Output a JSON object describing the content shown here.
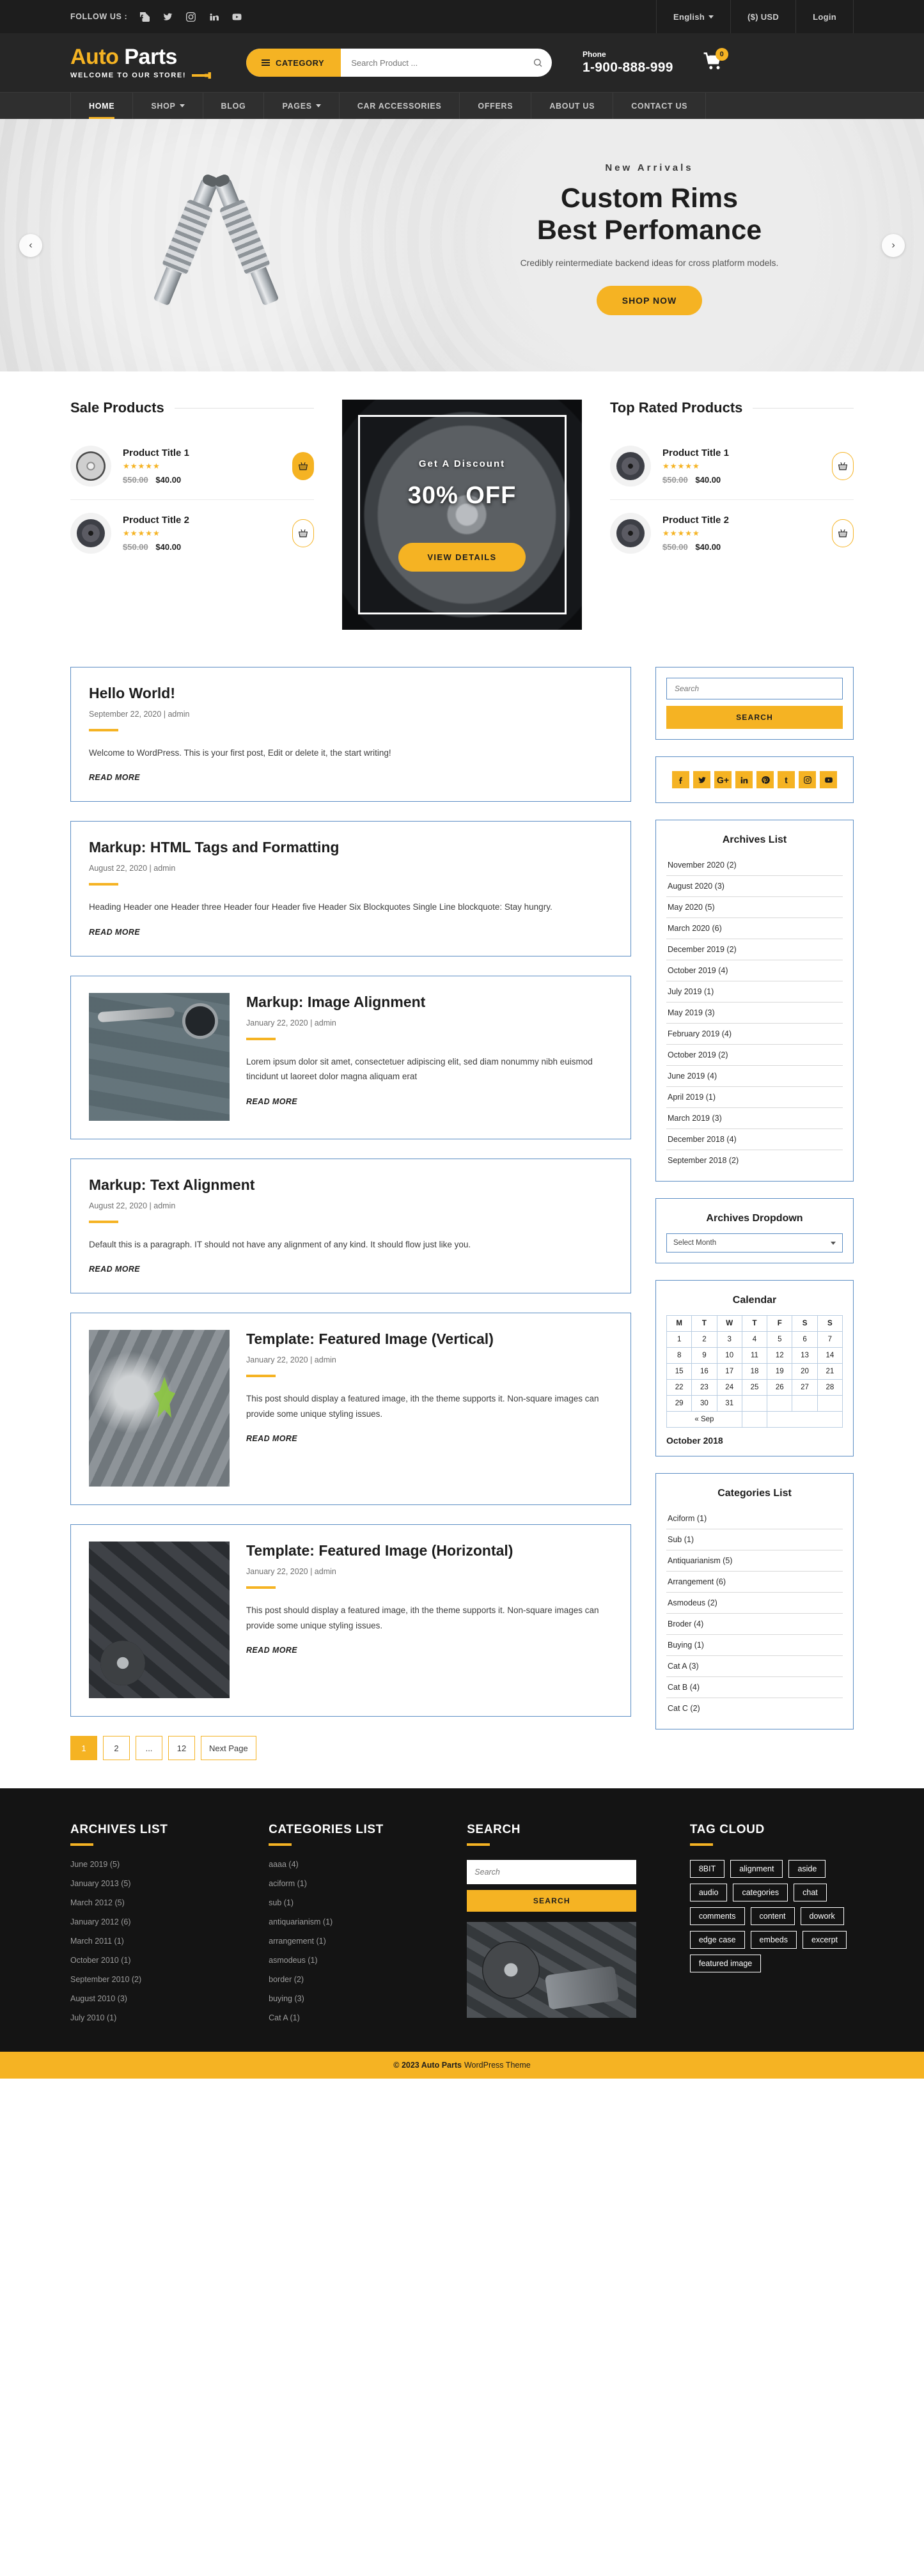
{
  "topbar": {
    "follow_label": "FOLLOW US :",
    "socials": [
      "facebook-icon",
      "twitter-icon",
      "instagram-icon",
      "linkedin-icon",
      "youtube-icon"
    ],
    "language": "English",
    "currency": "($) USD",
    "login": "Login"
  },
  "header": {
    "logo_auto": "Auto",
    "logo_parts": "Parts",
    "logo_tagline": "WELCOME TO OUR STORE!",
    "category_button": "CATEGORY",
    "search_placeholder": "Search Product ...",
    "search_value": "",
    "phone_label": "Phone",
    "phone_number": "1-900-888-999",
    "cart_count": "0"
  },
  "nav": {
    "items": [
      {
        "label": "HOME",
        "caret": false,
        "active": true
      },
      {
        "label": "SHOP",
        "caret": true,
        "active": false
      },
      {
        "label": "BLOG",
        "caret": false,
        "active": false
      },
      {
        "label": "PAGES",
        "caret": true,
        "active": false
      },
      {
        "label": "CAR ACCESSORIES",
        "caret": false,
        "active": false
      },
      {
        "label": "OFFERS",
        "caret": false,
        "active": false
      },
      {
        "label": "ABOUT US",
        "caret": false,
        "active": false
      },
      {
        "label": "CONTACT US",
        "caret": false,
        "active": false
      }
    ]
  },
  "hero": {
    "eyebrow": "New Arrivals",
    "title_line1": "Custom Rims",
    "title_line2": "Best Perfomance",
    "subtitle": "Credibly reintermediate backend ideas for cross platform models.",
    "cta": "SHOP NOW",
    "prev": "‹",
    "next": "›"
  },
  "sale_products": {
    "heading": "Sale Products",
    "items": [
      {
        "title": "Product Title 1",
        "stars": "★★★★★",
        "old_price": "$50.00",
        "new_price": "$40.00",
        "button_style": "solid"
      },
      {
        "title": "Product Title 2",
        "stars": "★★★★★",
        "old_price": "$50.00",
        "new_price": "$40.00",
        "button_style": "outline"
      }
    ]
  },
  "promo": {
    "small": "Get A Discount",
    "big": "30% OFF",
    "button": "VIEW DETAILS"
  },
  "top_rated": {
    "heading": "Top Rated Products",
    "items": [
      {
        "title": "Product Title 1",
        "stars": "★★★★★",
        "old_price": "$50.00",
        "new_price": "$40.00",
        "button_style": "outline"
      },
      {
        "title": "Product Title 2",
        "stars": "★★★★★",
        "old_price": "$50.00",
        "new_price": "$40.00",
        "button_style": "outline"
      }
    ]
  },
  "posts": [
    {
      "title": "Hello World!",
      "meta": "September 22, 2020 | admin",
      "body": "Welcome to WordPress. This is your first post, Edit or delete it, the start writing!",
      "read_more": "READ MORE",
      "image": "none"
    },
    {
      "title": "Markup: HTML Tags and Formatting",
      "meta": "August 22, 2020 | admin",
      "body": "Heading Header one Header three Header four Header five Header Six Blockquotes Single Line blockquote: Stay hungry.",
      "read_more": "READ MORE",
      "image": "none"
    },
    {
      "title": "Markup: Image Alignment",
      "meta": "January 22, 2020 | admin",
      "body": "Lorem ipsum dolor sit amet, consectetuer adipiscing elit, sed diam nonummy nibh euismod tincidunt ut laoreet dolor magna aliquam erat",
      "read_more": "READ MORE",
      "image": "tools"
    },
    {
      "title": "Markup: Text Alignment",
      "meta": "August 22, 2020 | admin",
      "body": "Default this is a paragraph. IT should not have any alignment of any kind. It should flow just like you.",
      "read_more": "READ MORE",
      "image": "none"
    },
    {
      "title": "Template: Featured Image (Vertical)",
      "meta": "January 22, 2020 | admin",
      "body": "This post should display a featured image, ith the theme supports it. Non-square images can provide some unique styling issues.",
      "read_more": "READ MORE",
      "image": "engine"
    },
    {
      "title": "Template: Featured Image (Horizontal)",
      "meta": "January 22, 2020 | admin",
      "body": "This post should display a featured image, ith the theme supports it. Non-square images can provide some unique styling issues.",
      "read_more": "READ MORE",
      "image": "parts"
    }
  ],
  "pagination": [
    {
      "label": "1",
      "active": true
    },
    {
      "label": "2",
      "active": false
    },
    {
      "label": "...",
      "active": false
    },
    {
      "label": "12",
      "active": false
    },
    {
      "label": "Next Page",
      "active": false
    }
  ],
  "sidebar": {
    "search_placeholder": "Search",
    "search_value": "",
    "search_button": "SEARCH",
    "socials": [
      "facebook-icon",
      "twitter-icon",
      "googleplus-icon",
      "linkedin-icon",
      "pinterest-icon",
      "tumblr-icon",
      "instagram-icon",
      "youtube-icon"
    ],
    "archives_title": "Archives List",
    "archives": [
      "November 2020 (2)",
      "August 2020 (3)",
      "May 2020 (5)",
      "March 2020 (6)",
      "December 2019 (2)",
      "October 2019 (4)",
      "July 2019 (1)",
      "May 2019 (3)",
      "February 2019 (4)",
      "October 2019 (2)",
      "June 2019 (4)",
      "April 2019 (1)",
      "March 2019 (3)",
      "December 2018 (4)",
      "September 2018 (2)"
    ],
    "dropdown_title": "Archives Dropdown",
    "dropdown_selected": "Select Month",
    "calendar_title": "Calendar",
    "calendar": {
      "weekdays": [
        "M",
        "T",
        "W",
        "T",
        "F",
        "S",
        "S"
      ],
      "weeks": [
        [
          "1",
          "2",
          "3",
          "4",
          "5",
          "6",
          "7"
        ],
        [
          "8",
          "9",
          "10",
          "11",
          "12",
          "13",
          "14"
        ],
        [
          "15",
          "16",
          "17",
          "18",
          "19",
          "20",
          "21"
        ],
        [
          "22",
          "23",
          "24",
          "25",
          "26",
          "27",
          "28"
        ],
        [
          "29",
          "30",
          "31",
          "",
          "",
          "",
          ""
        ]
      ],
      "prev_label": "« Sep",
      "caption": "October 2018"
    },
    "categories_title": "Categories List",
    "categories": [
      "Aciform (1)",
      "Sub (1)",
      "Antiquarianism (5)",
      "Arrangement (6)",
      "Asmodeus (2)",
      "Broder (4)",
      "Buying (1)",
      "Cat A (3)",
      "Cat B (4)",
      "Cat C (2)"
    ]
  },
  "footer": {
    "archives_title": "ARCHIVES LIST",
    "archives": [
      "June 2019 (5)",
      "January  2013 (5)",
      "March 2012 (5)",
      "January  2012 (6)",
      "March  2011 (1)",
      "October 2010 (1)",
      "September 2010 (2)",
      "August 2010 (3)",
      "July 2010 (1)"
    ],
    "categories_title": "CATEGORIES LIST",
    "categories": [
      "aaaa (4)",
      "aciform (1)",
      "sub (1)",
      "antiquarianism (1)",
      "arrangement (1)",
      "asmodeus (1)",
      "border (2)",
      "buying (3)",
      "Cat A (1)"
    ],
    "search_title": "SEARCH",
    "search_placeholder": "Search",
    "search_value": "",
    "search_button": "SEARCH",
    "tag_title": "TAG CLOUD",
    "tags": [
      "8BIT",
      "alignment",
      "aside",
      "audio",
      "categories",
      "chat",
      "comments",
      "content",
      "dowork",
      "edge case",
      "embeds",
      "excerpt",
      "featured image"
    ],
    "copyright": "© 2023 Auto Parts",
    "copyright_sub": "WordPress Theme"
  },
  "colors": {
    "accent": "#f5b323",
    "dark": "#1d1d1d",
    "border_blue": "#5b8dc4"
  }
}
